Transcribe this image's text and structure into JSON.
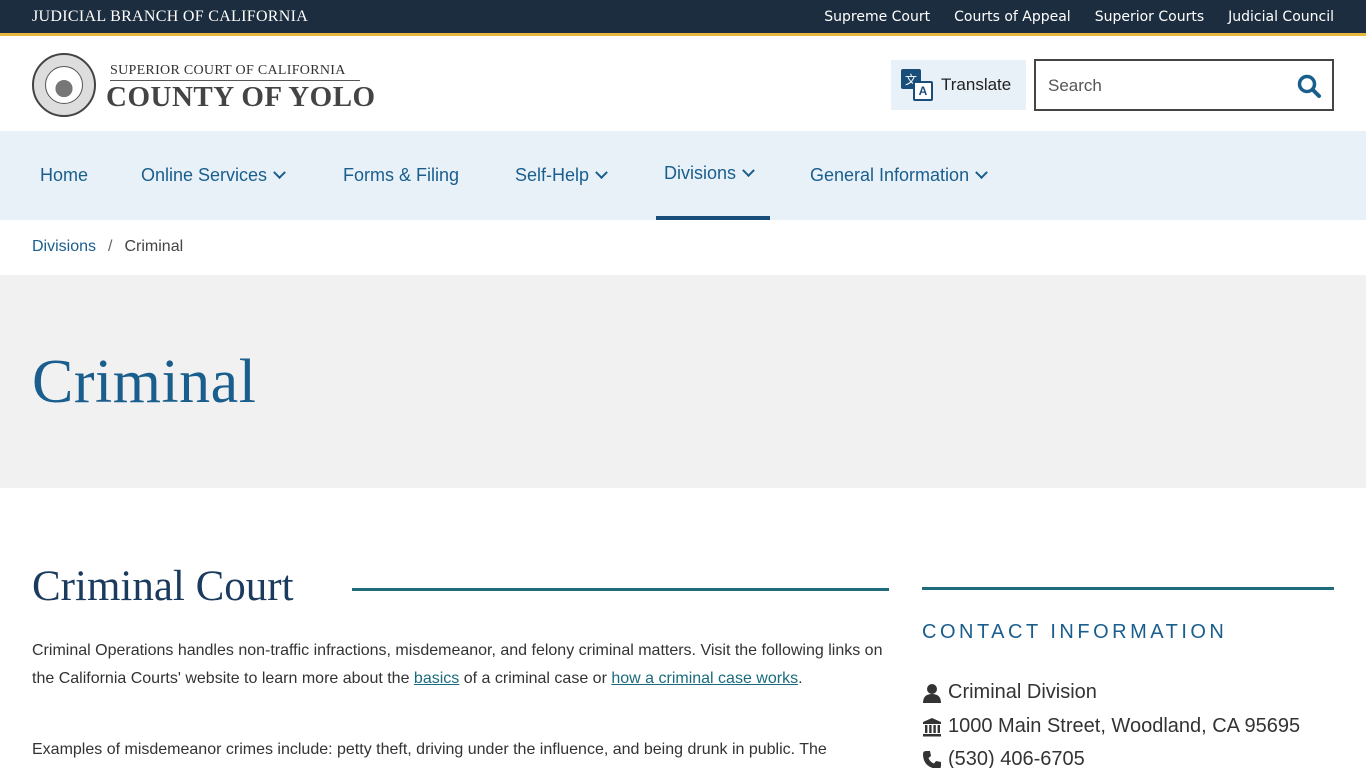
{
  "topbar": {
    "brand": "JUDICIAL BRANCH OF CALIFORNIA",
    "links": [
      "Supreme Court",
      "Courts of Appeal",
      "Superior Courts",
      "Judicial Council"
    ]
  },
  "header": {
    "court_line1": "SUPERIOR COURT OF CALIFORNIA",
    "court_line2": "COUNTY OF YOLO",
    "translate_label": "Translate",
    "search_placeholder": "Search"
  },
  "nav": {
    "items": [
      {
        "label": "Home"
      },
      {
        "label": "Online Services"
      },
      {
        "label": "Forms & Filing"
      },
      {
        "label": "Self-Help"
      },
      {
        "label": "Divisions"
      },
      {
        "label": "General Information"
      }
    ]
  },
  "breadcrumb": {
    "parent": "Divisions",
    "separator": "/",
    "current": "Criminal"
  },
  "hero": {
    "title": "Criminal"
  },
  "main": {
    "heading": "Criminal Court",
    "para1_a": "Criminal Operations handles non-traffic infractions, misdemeanor, and felony criminal matters. Visit the following links on the California Courts' website to learn more about the ",
    "para1_link1": "basics",
    "para1_b": " of a criminal case or ",
    "para1_link2": "how a criminal case works",
    "para1_c": ".",
    "para2": "Examples of misdemeanor crimes include: petty theft, driving under the influence, and being drunk in public. The"
  },
  "sidebar": {
    "title": "CONTACT INFORMATION",
    "division": "Criminal Division",
    "address": "1000 Main Street, Woodland, CA 95695",
    "phone": "(530) 406-6705"
  },
  "colors": {
    "topbar_bg": "#1c2d3f",
    "accent_gold": "#e8b53e",
    "nav_bg": "#e8f1f8",
    "link_blue": "#1a5e8e",
    "teal_rule": "#1e6b7d"
  }
}
